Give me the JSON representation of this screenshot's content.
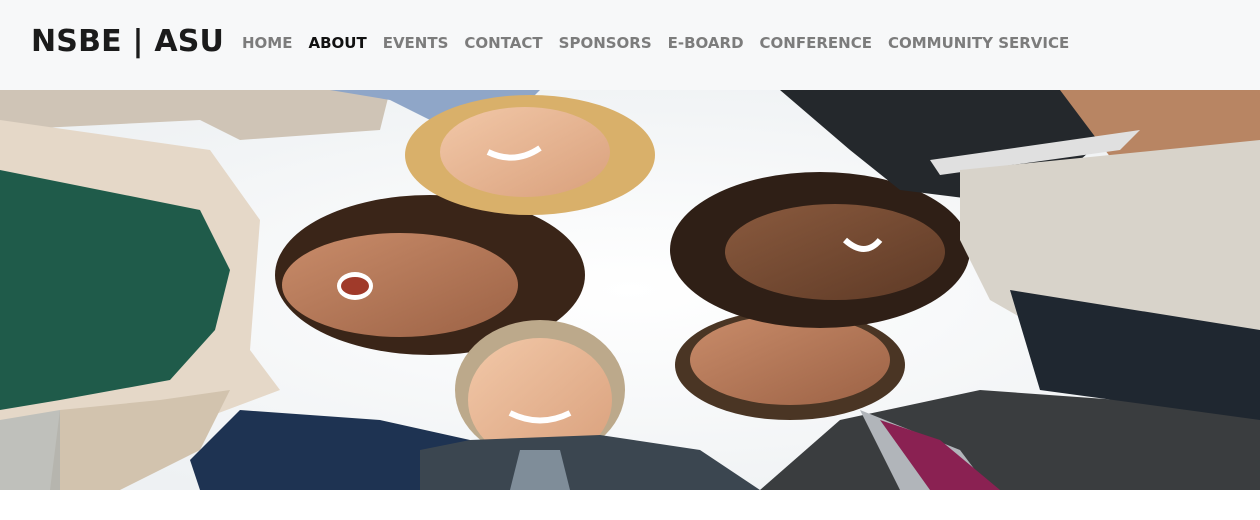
{
  "header": {
    "brand": "NSBE | ASU",
    "nav": [
      {
        "label": "HOME",
        "active": false
      },
      {
        "label": "ABOUT",
        "active": true
      },
      {
        "label": "EVENTS",
        "active": false
      },
      {
        "label": "CONTACT",
        "active": false
      },
      {
        "label": "SPONSORS",
        "active": false
      },
      {
        "label": "E-BOARD",
        "active": false
      },
      {
        "label": "CONFERENCE",
        "active": false
      },
      {
        "label": "COMMUNITY SERVICE",
        "active": false
      }
    ]
  },
  "hero": {
    "image": "group-huddle-photo"
  },
  "colors": {
    "navbar_bg": "#f7f8f9",
    "nav_text": "#7c7c7c",
    "nav_active": "#111111",
    "brand_text": "#1b1b1b"
  }
}
